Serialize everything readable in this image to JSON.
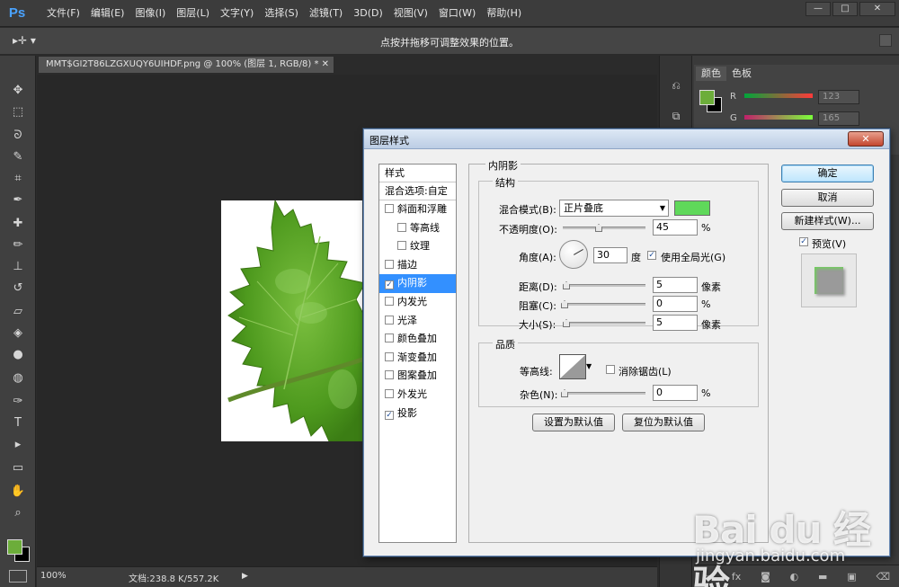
{
  "app": {
    "logo": "Ps",
    "menus": [
      "文件(F)",
      "编辑(E)",
      "图像(I)",
      "图层(L)",
      "文字(Y)",
      "选择(S)",
      "滤镜(T)",
      "3D(D)",
      "视图(V)",
      "窗口(W)",
      "帮助(H)"
    ],
    "window_buttons": {
      "minimize": "—",
      "maximize": "□",
      "close": "✕"
    }
  },
  "options_bar": {
    "tool_glyph": "▸✛ ▾",
    "hint": "点按并拖移可调整效果的位置。"
  },
  "document": {
    "tab_title": "MMT$GI2T86LZGXUQY6UIHDF.png @ 100% (图层 1, RGB/8) *  ✕",
    "zoom": "100%",
    "doc_info": "文档:238.8 K/557.2K",
    "status_arrow": "▶"
  },
  "toolbox": {
    "tools": [
      {
        "name": "move-tool",
        "glyph": "✥"
      },
      {
        "name": "marquee-tool",
        "glyph": "⬚"
      },
      {
        "name": "lasso-tool",
        "glyph": "ᘐ"
      },
      {
        "name": "quick-select-tool",
        "glyph": "✎"
      },
      {
        "name": "crop-tool",
        "glyph": "⌗"
      },
      {
        "name": "eyedropper-tool",
        "glyph": "✒"
      },
      {
        "name": "healing-tool",
        "glyph": "✚"
      },
      {
        "name": "brush-tool",
        "glyph": "✏"
      },
      {
        "name": "stamp-tool",
        "glyph": "⊥"
      },
      {
        "name": "history-brush-tool",
        "glyph": "↺"
      },
      {
        "name": "eraser-tool",
        "glyph": "▱"
      },
      {
        "name": "paint-bucket-tool",
        "glyph": "◈"
      },
      {
        "name": "blur-tool",
        "glyph": "●"
      },
      {
        "name": "dodge-tool",
        "glyph": "◍"
      },
      {
        "name": "pen-tool",
        "glyph": "✑"
      },
      {
        "name": "type-tool",
        "glyph": "T"
      },
      {
        "name": "path-select-tool",
        "glyph": "▸"
      },
      {
        "name": "shape-tool",
        "glyph": "▭"
      },
      {
        "name": "hand-tool",
        "glyph": "✋"
      },
      {
        "name": "zoom-tool",
        "glyph": "⌕"
      }
    ],
    "foreground_color": "#6cad3a",
    "background_color": "#000000"
  },
  "color_panel": {
    "tabs": [
      "颜色",
      "色板"
    ],
    "channels": [
      {
        "label": "R",
        "value": "123"
      },
      {
        "label": "G",
        "value": "165"
      }
    ]
  },
  "dialog": {
    "title": "图层样式",
    "close": "✕",
    "styles_header": "样式",
    "blend_options": "混合选项:自定",
    "styles": [
      {
        "label": "斜面和浮雕",
        "checked": false,
        "sub": false
      },
      {
        "label": "等高线",
        "checked": false,
        "sub": true
      },
      {
        "label": "纹理",
        "checked": false,
        "sub": true
      },
      {
        "label": "描边",
        "checked": false,
        "sub": false
      },
      {
        "label": "内阴影",
        "checked": true,
        "sub": false,
        "selected": true
      },
      {
        "label": "内发光",
        "checked": false,
        "sub": false
      },
      {
        "label": "光泽",
        "checked": false,
        "sub": false
      },
      {
        "label": "颜色叠加",
        "checked": false,
        "sub": false
      },
      {
        "label": "渐变叠加",
        "checked": false,
        "sub": false
      },
      {
        "label": "图案叠加",
        "checked": false,
        "sub": false
      },
      {
        "label": "外发光",
        "checked": false,
        "sub": false
      },
      {
        "label": "投影",
        "checked": true,
        "sub": false
      }
    ],
    "section_title": "内阴影",
    "structure": {
      "legend": "结构",
      "blend_mode_label": "混合模式(B):",
      "blend_mode_value": "正片叠底",
      "shadow_color": "#5fd85a",
      "opacity_label": "不透明度(O):",
      "opacity_value": "45",
      "opacity_unit": "%",
      "angle_label": "角度(A):",
      "angle_value": "30",
      "angle_unit": "度",
      "global_light_label": "使用全局光(G)",
      "distance_label": "距离(D):",
      "distance_value": "5",
      "distance_unit": "像素",
      "choke_label": "阻塞(C):",
      "choke_value": "0",
      "choke_unit": "%",
      "size_label": "大小(S):",
      "size_value": "5",
      "size_unit": "像素"
    },
    "quality": {
      "legend": "品质",
      "contour_label": "等高线:",
      "antialias_label": "消除锯齿(L)",
      "noise_label": "杂色(N):",
      "noise_value": "0",
      "noise_unit": "%"
    },
    "set_default_button": "设置为默认值",
    "reset_default_button": "复位为默认值",
    "ok_button": "确定",
    "cancel_button": "取消",
    "new_style_button": "新建样式(W)...",
    "preview_label": "预览(V)"
  },
  "watermark": {
    "logo": "Bai du 经验",
    "url": "jingyan.baidu.com"
  }
}
